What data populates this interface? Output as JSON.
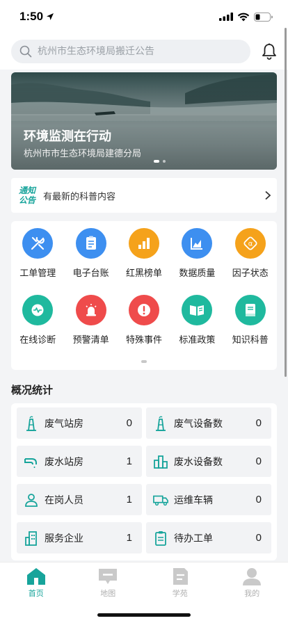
{
  "status_bar": {
    "time": "1:50"
  },
  "search": {
    "placeholder": "杭州市生态环境局搬迁公告"
  },
  "banner": {
    "title": "环境监测在行动",
    "subtitle": "杭州市市生态环境局建德分局"
  },
  "notice": {
    "tag_line1": "通知",
    "tag_line2": "公告",
    "text": "有最新的科普内容"
  },
  "menu": {
    "items": [
      {
        "label": "工单管理",
        "icon": "wrench-icon",
        "color": "#3d8ff0"
      },
      {
        "label": "电子台账",
        "icon": "document-icon",
        "color": "#3d8ff0"
      },
      {
        "label": "红黑榜单",
        "icon": "bar-chart-icon",
        "color": "#f5a21b"
      },
      {
        "label": "数据质量",
        "icon": "area-chart-icon",
        "color": "#3d8ff0"
      },
      {
        "label": "因子状态",
        "icon": "factor-icon",
        "color": "#f5a21b"
      },
      {
        "label": "在线诊断",
        "icon": "pulse-icon",
        "color": "#1fb99e"
      },
      {
        "label": "预警清单",
        "icon": "siren-icon",
        "color": "#ef4b4b"
      },
      {
        "label": "特殊事件",
        "icon": "alert-icon",
        "color": "#ef4b4b"
      },
      {
        "label": "标准政策",
        "icon": "book-open-icon",
        "color": "#1fb99e"
      },
      {
        "label": "知识科普",
        "icon": "book-icon",
        "color": "#1fb99e"
      }
    ]
  },
  "stats": {
    "title": "概况统计",
    "items": [
      {
        "label": "废气站房",
        "value": "0",
        "icon": "chimney-icon"
      },
      {
        "label": "废气设备数",
        "value": "0",
        "icon": "chimney-icon"
      },
      {
        "label": "废水站房",
        "value": "1",
        "icon": "faucet-icon"
      },
      {
        "label": "废水设备数",
        "value": "0",
        "icon": "buildings-icon"
      },
      {
        "label": "在岗人员",
        "value": "1",
        "icon": "person-icon"
      },
      {
        "label": "运维车辆",
        "value": "0",
        "icon": "truck-icon"
      },
      {
        "label": "服务企业",
        "value": "1",
        "icon": "building-icon"
      },
      {
        "label": "待办工单",
        "value": "0",
        "icon": "clipboard-icon"
      }
    ]
  },
  "tabbar": {
    "items": [
      {
        "label": "首页",
        "icon": "home-icon"
      },
      {
        "label": "地图",
        "icon": "map-icon"
      },
      {
        "label": "学苑",
        "icon": "study-icon"
      },
      {
        "label": "我的",
        "icon": "profile-icon"
      }
    ]
  },
  "colors": {
    "accent": "#17a49b",
    "blue": "#3d8ff0",
    "orange": "#f5a21b",
    "red": "#ef4b4b",
    "green": "#1fb99e"
  }
}
